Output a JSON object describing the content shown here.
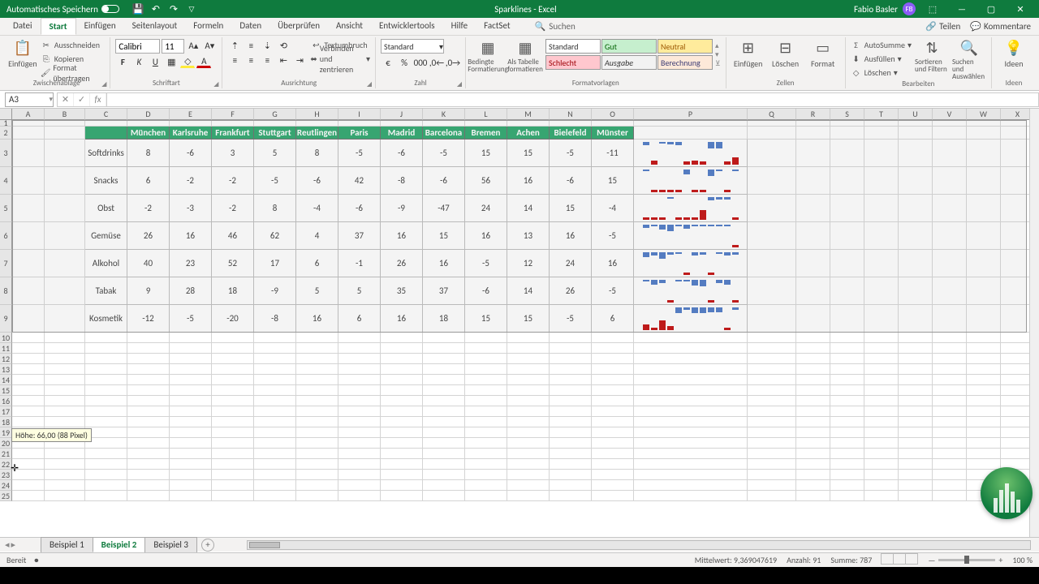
{
  "title_bar": {
    "autosave": "Automatisches Speichern",
    "doc": "Sparklines",
    "app": "Excel",
    "user": "Fabio Basler",
    "initials": "FB"
  },
  "tabs": {
    "list": [
      "Datei",
      "Start",
      "Einfügen",
      "Seitenlayout",
      "Formeln",
      "Daten",
      "Überprüfen",
      "Ansicht",
      "Entwicklertools",
      "Hilfe",
      "FactSet"
    ],
    "active": 1,
    "search": "Suchen",
    "share": "Teilen",
    "comments": "Kommentare"
  },
  "ribbon": {
    "clipboard": {
      "label": "Zwischenablage",
      "paste": "Einfügen",
      "cut": "Ausschneiden",
      "copy": "Kopieren",
      "format": "Format übertragen"
    },
    "font": {
      "label": "Schriftart",
      "name": "Calibri",
      "size": "11"
    },
    "alignment": {
      "label": "Ausrichtung",
      "wrap": "Textumbruch",
      "merge": "Verbinden und zentrieren"
    },
    "number": {
      "label": "Zahl",
      "format": "Standard"
    },
    "styles": {
      "label": "Formatvorlagen",
      "cond": "Bedingte Formatierung",
      "table": "Als Tabelle formatieren",
      "standard": "Standard",
      "gut": "Gut",
      "neutral": "Neutral",
      "schlecht": "Schlecht",
      "ausgabe": "Ausgabe",
      "berechnung": "Berechnung"
    },
    "cells": {
      "label": "Zellen",
      "insert": "Einfügen",
      "delete": "Löschen",
      "format": "Format"
    },
    "editing": {
      "label": "Bearbeiten",
      "autosum": "AutoSumme",
      "fill": "Ausfüllen",
      "clear": "Löschen",
      "sort": "Sortieren und Filtern",
      "find": "Suchen und Auswählen"
    },
    "ideas": {
      "label": "Ideen",
      "btn": "Ideen"
    }
  },
  "name_box": "A3",
  "tooltip": "Höhe: 66,00 (88 Pixel)",
  "chart_data": {
    "type": "table",
    "headers": [
      "München",
      "Karlsruhe",
      "Frankfurt",
      "Stuttgart",
      "Reutlingen",
      "Paris",
      "Madrid",
      "Barcelona",
      "Bremen",
      "Achen",
      "Bielefeld",
      "Münster"
    ],
    "rows": [
      {
        "label": "Softdrinks",
        "v": [
          8,
          -6,
          3,
          5,
          8,
          -5,
          -6,
          -5,
          15,
          15,
          -5,
          -11
        ]
      },
      {
        "label": "Snacks",
        "v": [
          6,
          -2,
          -2,
          -5,
          -6,
          42,
          -8,
          -6,
          56,
          16,
          -6,
          15
        ]
      },
      {
        "label": "Obst",
        "v": [
          -2,
          -3,
          -2,
          8,
          -4,
          -6,
          -9,
          -47,
          24,
          14,
          15,
          -4
        ]
      },
      {
        "label": "Gemüse",
        "v": [
          26,
          16,
          46,
          62,
          4,
          37,
          16,
          15,
          16,
          13,
          16,
          -5
        ]
      },
      {
        "label": "Alkohol",
        "v": [
          40,
          23,
          52,
          17,
          6,
          -1,
          26,
          16,
          -5,
          12,
          24,
          16
        ]
      },
      {
        "label": "Tabak",
        "v": [
          9,
          28,
          18,
          -9,
          5,
          5,
          35,
          37,
          -6,
          14,
          26,
          -5
        ]
      },
      {
        "label": "Kosmetik",
        "v": [
          -12,
          -5,
          -20,
          -8,
          16,
          6,
          16,
          18,
          15,
          15,
          -5,
          6
        ]
      }
    ]
  },
  "sheets": {
    "list": [
      "Beispiel 1",
      "Beispiel 2",
      "Beispiel 3"
    ],
    "active": 1
  },
  "status": {
    "ready": "Bereit",
    "avg_l": "Mittelwert:",
    "avg_v": "9,369047619",
    "count_l": "Anzahl:",
    "count_v": "91",
    "sum_l": "Summe:",
    "sum_v": "787",
    "zoom": "100 %"
  }
}
